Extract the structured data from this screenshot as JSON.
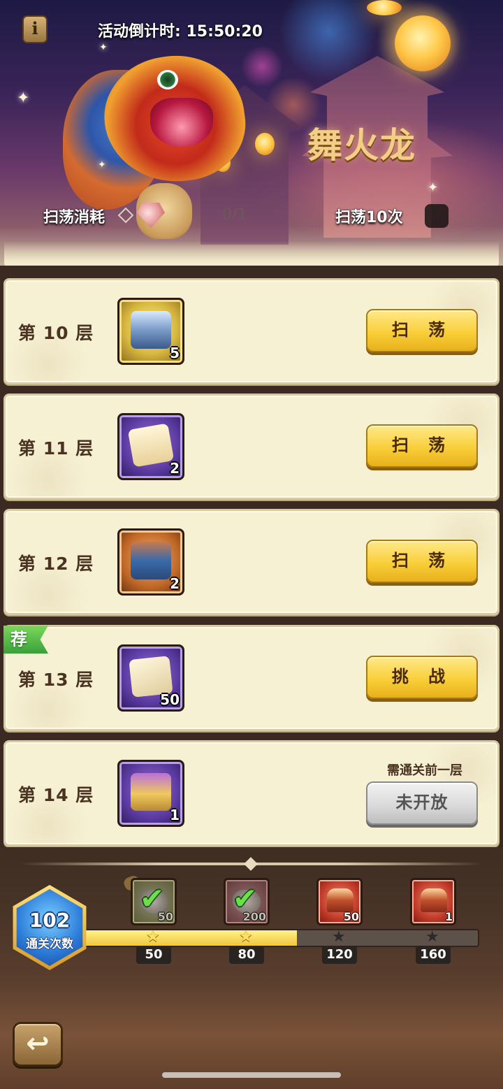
{
  "header": {
    "info_icon": "i",
    "countdown": "活动倒计时: 15:50:20",
    "event_title": "舞火龙",
    "sweep_cost_label": "扫荡消耗",
    "sweep_cost_count": "0/1",
    "sweep_ten_label": "扫荡10次"
  },
  "floors": [
    {
      "label": "第 10 层",
      "reward_icon": "silver-chest-icon",
      "reward_qty": "5",
      "action": "扫 荡",
      "state": "sweep"
    },
    {
      "label": "第 11 层",
      "reward_icon": "scroll-icon",
      "reward_qty": "2",
      "action": "扫 荡",
      "state": "sweep"
    },
    {
      "label": "第 12 层",
      "reward_icon": "blue-chest-icon",
      "reward_qty": "2",
      "action": "扫 荡",
      "state": "sweep"
    },
    {
      "label": "第 13 层",
      "reward_icon": "treasure-map-icon",
      "reward_qty": "50",
      "action": "挑 战",
      "state": "challenge",
      "tag": "荐"
    },
    {
      "label": "第 14 层",
      "reward_icon": "purple-chest-icon",
      "reward_qty": "1",
      "action": "未开放",
      "state": "locked",
      "hint": "需通关前一层"
    }
  ],
  "progress": {
    "clear_count": "102",
    "clear_label": "通关次数",
    "fill_fraction": 0.54,
    "milestones": [
      {
        "value": "50",
        "qty": "50",
        "claimed": true,
        "reward_icon": "ore-icon"
      },
      {
        "value": "80",
        "qty": "200",
        "claimed": true,
        "reward_icon": "ore-icon"
      },
      {
        "value": "120",
        "qty": "50",
        "claimed": false,
        "reward_icon": "red-chest-icon"
      },
      {
        "value": "160",
        "qty": "1",
        "claimed": false,
        "reward_icon": "red-chest-icon"
      }
    ]
  },
  "footer": {
    "back_icon": "↩"
  },
  "colors": {
    "card_bg": "#f7f1d4",
    "button_yellow": "#f8cf3a",
    "button_locked": "#d8d8d8",
    "progress_fill": "#f0c83a",
    "recommend_green": "#3aa03a"
  }
}
